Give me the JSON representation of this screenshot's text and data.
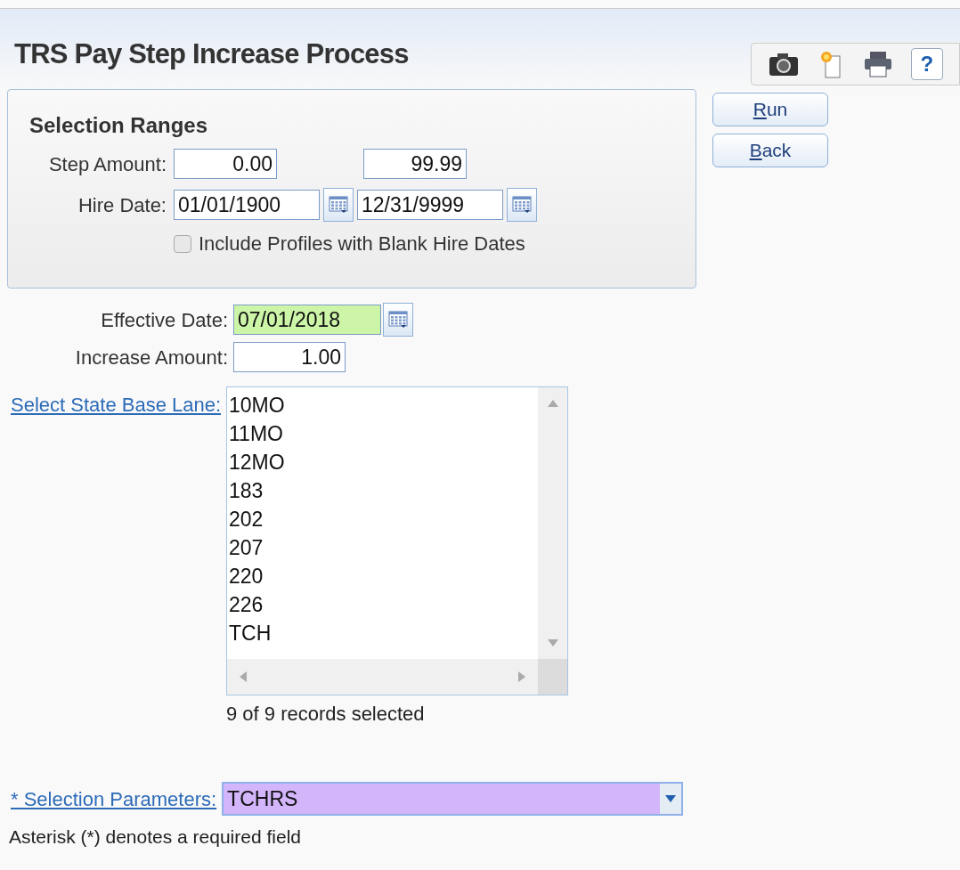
{
  "title": "TRS Pay Step Increase Process",
  "toolbar": [
    {
      "kind": "camera"
    },
    {
      "kind": "note"
    },
    {
      "kind": "print"
    },
    {
      "kind": "help",
      "label": "?"
    }
  ],
  "selection_ranges": {
    "heading": "Selection Ranges",
    "step_amount": {
      "label": "Step Amount:",
      "from": "0.00",
      "to": "99.99"
    },
    "hire_date": {
      "label": "Hire Date:",
      "from": "01/01/1900",
      "to": "12/31/9999"
    },
    "blank_hire_dates": {
      "label": "Include Profiles with Blank Hire Dates",
      "checked": false
    }
  },
  "buttons": [
    {
      "label": "Run"
    },
    {
      "label": "Back"
    }
  ],
  "effective_date": {
    "label": "Effective Date:",
    "value": "07/01/2018"
  },
  "increase_amount": {
    "label": "Increase Amount:",
    "value": "1.00"
  },
  "state_base_lane": {
    "label": "Select State Base Lane:",
    "items": [
      "10MO",
      "11MO",
      "12MO",
      "183",
      "202",
      "207",
      "220",
      "226",
      "TCH"
    ],
    "summary": "9 of 9 records selected"
  },
  "selection_parameters": {
    "label": "* Selection Parameters:",
    "value": "TCHRS"
  },
  "footnote": "Asterisk (*) denotes a required field"
}
